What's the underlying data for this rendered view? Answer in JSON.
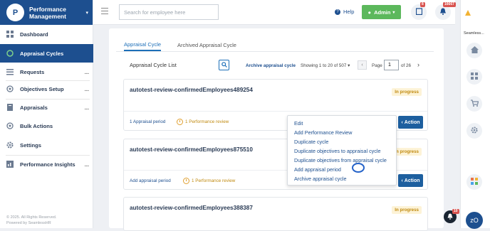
{
  "brand": {
    "logo_text": "P",
    "title": "Performance Management"
  },
  "sidebar": {
    "items": [
      {
        "label": "Dashboard"
      },
      {
        "label": "Appraisal Cycles"
      },
      {
        "label": "Requests"
      },
      {
        "label": "Objectives Setup"
      },
      {
        "label": "Appraisals"
      },
      {
        "label": "Bulk Actions"
      },
      {
        "label": "Settings"
      },
      {
        "label": "Performance Insights"
      }
    ],
    "more": "...",
    "footer_line1": "© 2025. All Rights Reserved.",
    "footer_line2": "Powered by SeamlessHR"
  },
  "topbar": {
    "search_placeholder": "Search for employee here",
    "help_label": "Help",
    "admin_label": "Admin",
    "tasks_badge": "8",
    "notif_badge": "16667"
  },
  "right_panel": {
    "brand": "Seamless...",
    "avatar_initials": "zO",
    "float_badge": "10"
  },
  "tabs": [
    {
      "label": "Appraisal Cycle"
    },
    {
      "label": "Archived Appraisal Cycle"
    }
  ],
  "list": {
    "title": "Appraisal Cycle List",
    "archive_link": "Archive appraisal cycle",
    "showing": "Showing 1 to 20 of 507",
    "page_label": "Page",
    "page_value": "1",
    "page_of": "of",
    "page_total": "26"
  },
  "items": [
    {
      "title": "autotest-review-confirmedEmployees489254",
      "status": "In progress",
      "period_text": "1 Appraisal period",
      "review_text": "1 Performance review",
      "action_label": "Action"
    },
    {
      "title": "autotest-review-confirmedEmployees875510",
      "status": "In progress",
      "period_text": "Add appraisal period",
      "review_text": "1 Performance review",
      "action_label": "Action"
    },
    {
      "title": "autotest-review-confirmedEmployees388387",
      "status": "In progress"
    }
  ],
  "action_menu": [
    {
      "label": "Edit"
    },
    {
      "label": "Add Performance Review"
    },
    {
      "label": "Duplicate cycle"
    },
    {
      "label": "Duplicate objectives to appraisal cycle"
    },
    {
      "label": "Duplicate objectives from appraisal cycle"
    },
    {
      "label": "Add appraisal period"
    },
    {
      "label": "Archive appraisal cycle"
    }
  ],
  "colors": {
    "brand": "#1d4f8f",
    "admin": "#5cb85c",
    "status_bg": "#fdf3d7",
    "status_text": "#c08a10",
    "badge": "#d9534f"
  }
}
